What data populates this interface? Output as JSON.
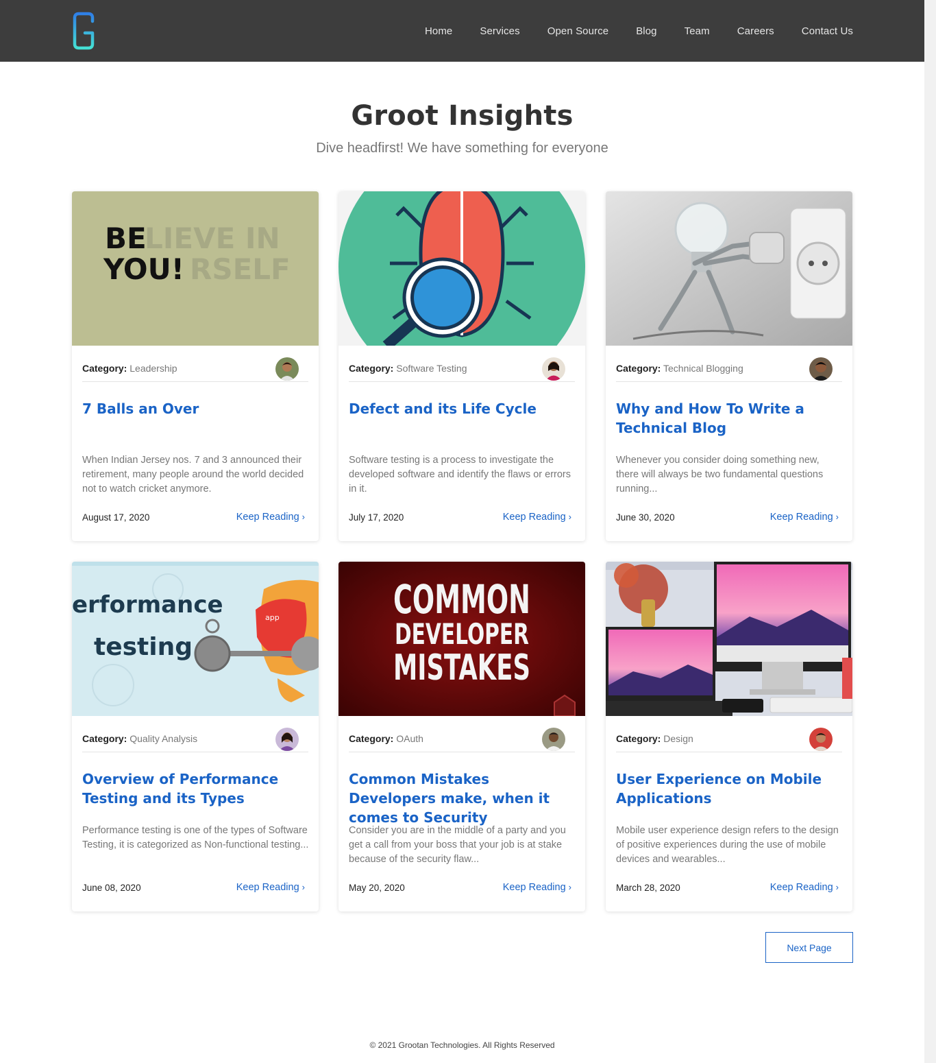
{
  "nav": {
    "links": [
      "Home",
      "Services",
      "Open Source",
      "Blog",
      "Team",
      "Careers",
      "Contact Us"
    ]
  },
  "hero": {
    "title": "Groot Insights",
    "subtitle": "Dive headfirst! We have something for everyone"
  },
  "labels": {
    "category": "Category:",
    "keep_reading": "Keep Reading",
    "chevron": "›"
  },
  "posts": [
    {
      "category": "Leadership",
      "title": "7 Balls an Over",
      "excerpt": "When Indian Jersey nos. 7 and 3 announced their retirement, many people around the world decided not to watch cricket anymore.",
      "date": "August 17, 2020",
      "image_icon": "believe-in-yourself-image",
      "image_text": [
        "BE",
        "LIEVE IN",
        "YOU!",
        "RSELF"
      ]
    },
    {
      "category": "Software Testing",
      "title": "Defect and its Life Cycle",
      "excerpt": "Software testing is a process to investigate the developed software and identify the flaws or errors in it.",
      "date": "July 17, 2020",
      "image_icon": "bug-magnifier-image"
    },
    {
      "category": "Technical Blogging",
      "title": "Why and How To Write a Technical Blog",
      "excerpt": "Whenever you consider doing something new, there will always be two fundamental questions running...",
      "date": "June 30, 2020",
      "image_icon": "lightbulb-robot-plug-image"
    },
    {
      "category": "Quality Analysis",
      "title": "Overview of Performance Testing and its Types",
      "excerpt": "Performance testing is one of the types of Software Testing, it is categorized as Non-functional testing...",
      "date": "June 08, 2020",
      "image_icon": "performance-testing-image",
      "image_text": [
        "erformance",
        "testing",
        "app"
      ]
    },
    {
      "category": "OAuth",
      "title": "Common Mistakes Developers make, when it comes to Security",
      "excerpt": "Consider you are in the middle of a party and you get a call from your boss that your job is at stake because of the security flaw...",
      "date": "May 20, 2020",
      "image_icon": "common-developer-mistakes-image",
      "image_text": [
        "COMMON",
        "DEVELOPER",
        "MISTAKES"
      ]
    },
    {
      "category": "Design",
      "title": "User Experience on Mobile Applications",
      "excerpt": "Mobile user experience design refers to the design of positive experiences during the use of mobile devices and wearables...",
      "date": "March 28, 2020",
      "image_icon": "desk-devices-image"
    }
  ],
  "pagination": {
    "next_label": "Next Page"
  },
  "footer": {
    "copyright": "© 2021 Grootan Technologies. All Rights Reserved"
  },
  "colors": {
    "nav_bg": "#3d3d3d",
    "link_blue": "#1a63c6",
    "logo_gradient": [
      "#2f7fe6",
      "#45e0d4"
    ]
  }
}
